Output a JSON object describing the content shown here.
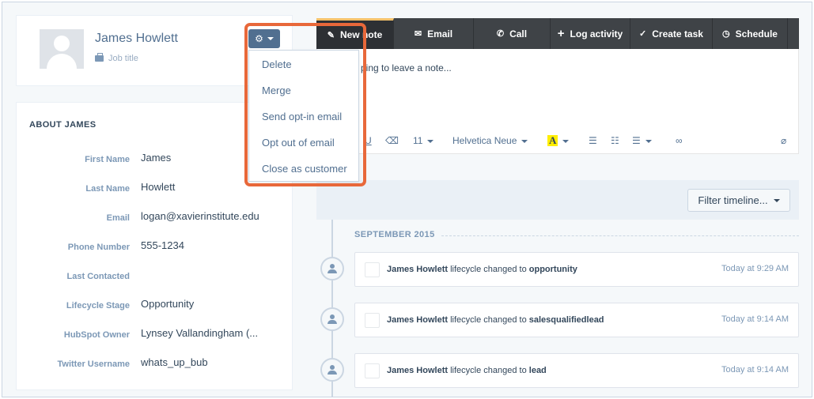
{
  "profile": {
    "name": "James Howlett",
    "job_title_placeholder": "Job title"
  },
  "about": {
    "heading": "ABOUT JAMES",
    "properties": [
      {
        "label": "First Name",
        "value": "James"
      },
      {
        "label": "Last Name",
        "value": "Howlett"
      },
      {
        "label": "Email",
        "value": "logan@xavierinstitute.edu"
      },
      {
        "label": "Phone Number",
        "value": "555-1234"
      },
      {
        "label": "Last Contacted",
        "value": ""
      },
      {
        "label": "Lifecycle Stage",
        "value": "Opportunity"
      },
      {
        "label": "HubSpot Owner",
        "value": "Lynsey Vallandingham (..."
      },
      {
        "label": "Twitter Username",
        "value": "whats_up_bub"
      }
    ]
  },
  "actions_menu": {
    "button_icon": "gear-icon",
    "items": [
      "Delete",
      "Merge",
      "Send opt-in email",
      "Opt out of email",
      "Close as customer"
    ],
    "highlight_color": "#e8683a"
  },
  "activity_tabs": [
    {
      "label": "New note",
      "icon": "pencil-icon",
      "glyph": "✎"
    },
    {
      "label": "Email",
      "icon": "envelope-icon",
      "glyph": "✉"
    },
    {
      "label": "Call",
      "icon": "phone-icon",
      "glyph": "✆"
    },
    {
      "label": "Log activity",
      "icon": "plus-icon",
      "glyph": "+"
    },
    {
      "label": "Create task",
      "icon": "check-circle-icon",
      "glyph": "✓"
    },
    {
      "label": "Schedule",
      "icon": "clock-icon",
      "glyph": "◷"
    }
  ],
  "editor": {
    "placeholder": "ping to leave a note...",
    "font_size": "11",
    "font_family": "Helvetica Neue",
    "underline_glyph": "U",
    "text_color_glyph": "A"
  },
  "timeline": {
    "filter_label": "Filter timeline...",
    "month": "SEPTEMBER 2015",
    "events": [
      {
        "actor": "James Howlett",
        "action": " lifecycle changed to ",
        "value": "opportunity",
        "time": "Today at 9:29 AM"
      },
      {
        "actor": "James Howlett",
        "action": " lifecycle changed to ",
        "value": "salesqualifiedlead",
        "time": "Today at 9:14 AM"
      },
      {
        "actor": "James Howlett",
        "action": " lifecycle changed to ",
        "value": "lead",
        "time": "Today at 9:14 AM"
      }
    ]
  }
}
